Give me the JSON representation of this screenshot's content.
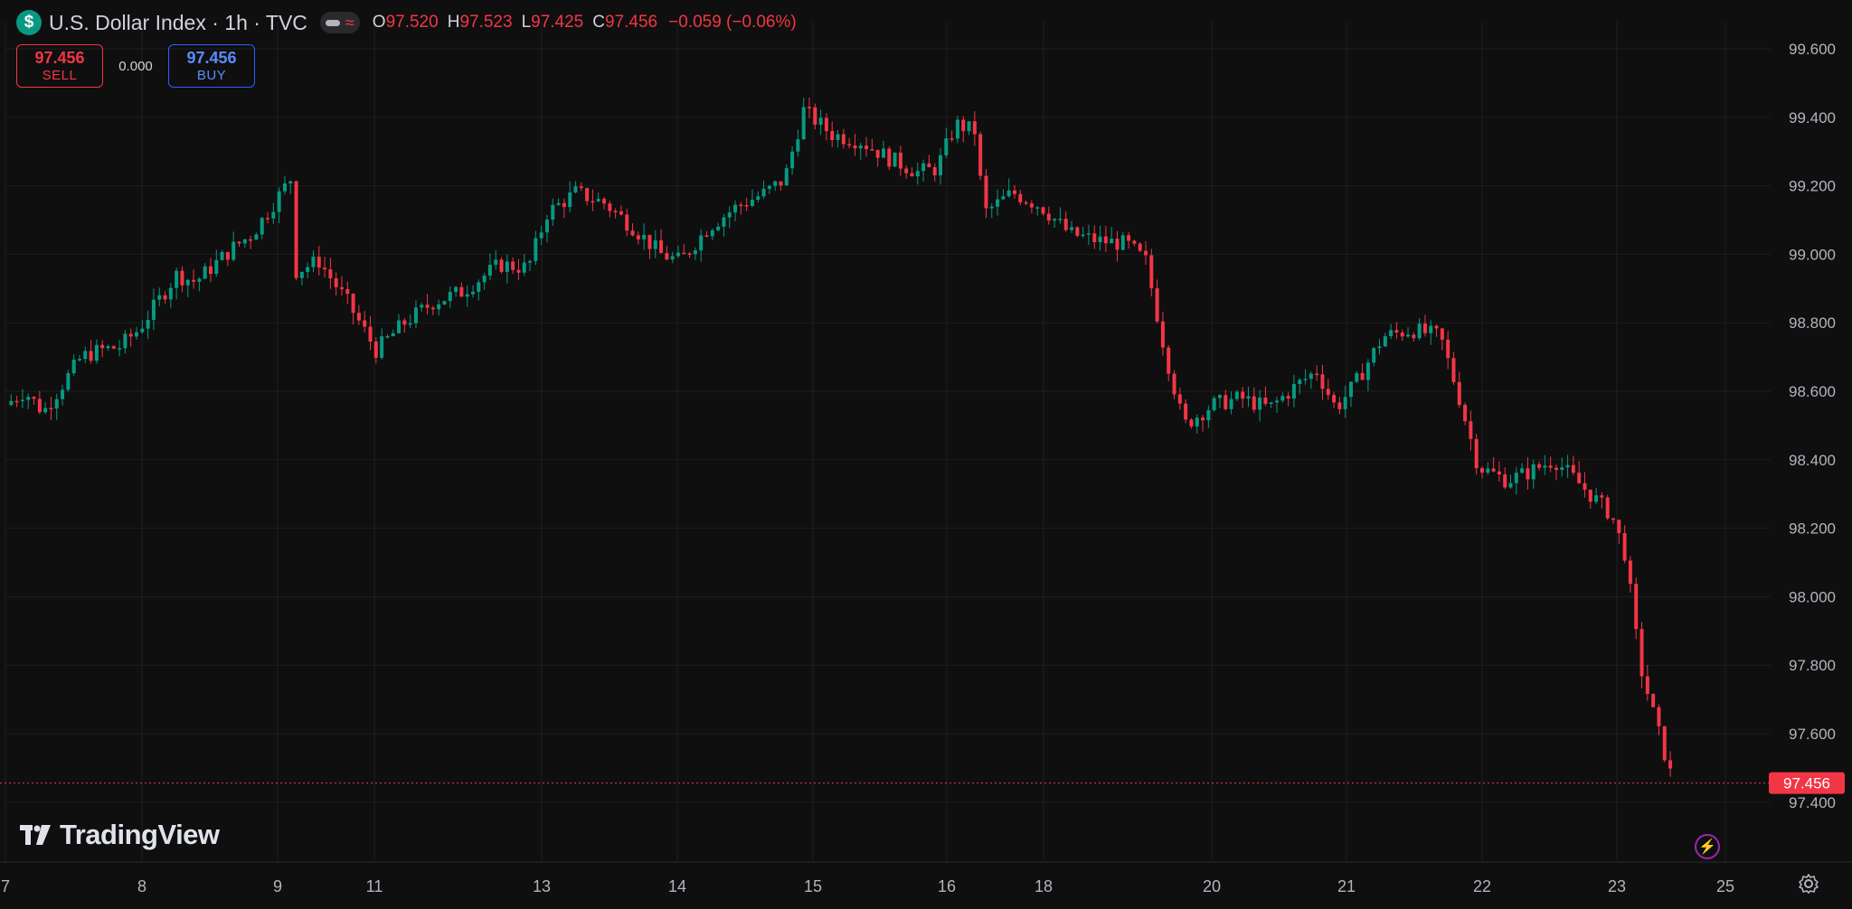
{
  "header": {
    "symbol_icon": "dollar-sign-icon",
    "symbol_glyph": "$",
    "title": "U.S. Dollar Index · 1h · TVC",
    "ohlc": {
      "o_label": "O",
      "o_value": "97.520",
      "h_label": "H",
      "h_value": "97.523",
      "l_label": "L",
      "l_value": "97.425",
      "c_label": "C",
      "c_value": "97.456",
      "change": "−0.059 (−0.06%)"
    }
  },
  "trade": {
    "sell_price": "97.456",
    "sell_label": "SELL",
    "spread": "0.000",
    "buy_price": "97.456",
    "buy_label": "BUY"
  },
  "logo_text": "TradingView",
  "colors": {
    "up": "#089981",
    "down": "#f23645",
    "background": "#0f0f0f",
    "grid": "#1f1f1f",
    "buy": "#2962ff"
  },
  "chart_data": {
    "type": "candlestick",
    "title": "U.S. Dollar Index · 1h · TVC",
    "ylim": [
      97.3,
      99.72
    ],
    "y_ticks": [
      "99.600",
      "99.400",
      "99.200",
      "99.000",
      "98.800",
      "98.600",
      "98.400",
      "98.200",
      "98.000",
      "97.800",
      "97.600",
      "97.400"
    ],
    "x_labels": [
      "7",
      "8",
      "9",
      "11",
      "13",
      "14",
      "15",
      "16",
      "18",
      "20",
      "21",
      "22",
      "23",
      "25"
    ],
    "last_price": "97.456",
    "close_path": [
      [
        0,
        98.56
      ],
      [
        0.2,
        98.6
      ],
      [
        0.4,
        98.54
      ],
      [
        0.6,
        98.62
      ],
      [
        0.8,
        98.7
      ],
      [
        1.0,
        98.72
      ],
      [
        1.2,
        98.73
      ],
      [
        1.4,
        98.78
      ],
      [
        1.6,
        98.86
      ],
      [
        1.8,
        98.94
      ],
      [
        2.0,
        98.92
      ],
      [
        2.2,
        98.97
      ],
      [
        2.4,
        99.02
      ],
      [
        2.6,
        99.06
      ],
      [
        2.8,
        99.14
      ],
      [
        3.0,
        99.22
      ],
      [
        3.05,
        98.95
      ],
      [
        3.3,
        98.98
      ],
      [
        3.6,
        98.86
      ],
      [
        3.9,
        98.72
      ],
      [
        4.2,
        98.8
      ],
      [
        4.5,
        98.86
      ],
      [
        4.8,
        98.89
      ],
      [
        5.0,
        98.93
      ],
      [
        5.2,
        98.97
      ],
      [
        5.5,
        98.96
      ],
      [
        5.7,
        99.12
      ],
      [
        6.0,
        99.18
      ],
      [
        6.3,
        99.15
      ],
      [
        6.6,
        99.08
      ],
      [
        6.9,
        99.0
      ],
      [
        7.1,
        98.98
      ],
      [
        7.4,
        99.08
      ],
      [
        7.7,
        99.14
      ],
      [
        8.0,
        99.18
      ],
      [
        8.2,
        99.22
      ],
      [
        8.4,
        99.42
      ],
      [
        8.7,
        99.35
      ],
      [
        9.0,
        99.33
      ],
      [
        9.3,
        99.28
      ],
      [
        9.6,
        99.24
      ],
      [
        9.8,
        99.25
      ],
      [
        10.0,
        99.38
      ],
      [
        10.2,
        99.36
      ],
      [
        10.3,
        99.12
      ],
      [
        10.6,
        99.18
      ],
      [
        10.9,
        99.14
      ],
      [
        11.2,
        99.06
      ],
      [
        11.5,
        99.04
      ],
      [
        11.8,
        99.03
      ],
      [
        12.0,
        98.98
      ],
      [
        12.2,
        98.72
      ],
      [
        12.4,
        98.5
      ],
      [
        12.7,
        98.56
      ],
      [
        13.0,
        98.58
      ],
      [
        13.3,
        98.55
      ],
      [
        13.6,
        98.62
      ],
      [
        13.8,
        98.66
      ],
      [
        14.0,
        98.55
      ],
      [
        14.2,
        98.62
      ],
      [
        14.5,
        98.76
      ],
      [
        14.8,
        98.78
      ],
      [
        15.1,
        98.76
      ],
      [
        15.3,
        98.58
      ],
      [
        15.5,
        98.38
      ],
      [
        15.8,
        98.34
      ],
      [
        16.0,
        98.36
      ],
      [
        16.3,
        98.4
      ],
      [
        16.6,
        98.32
      ],
      [
        16.9,
        98.24
      ],
      [
        17.05,
        98.12
      ],
      [
        17.2,
        97.8
      ],
      [
        17.4,
        97.6
      ],
      [
        17.55,
        97.456
      ]
    ]
  }
}
